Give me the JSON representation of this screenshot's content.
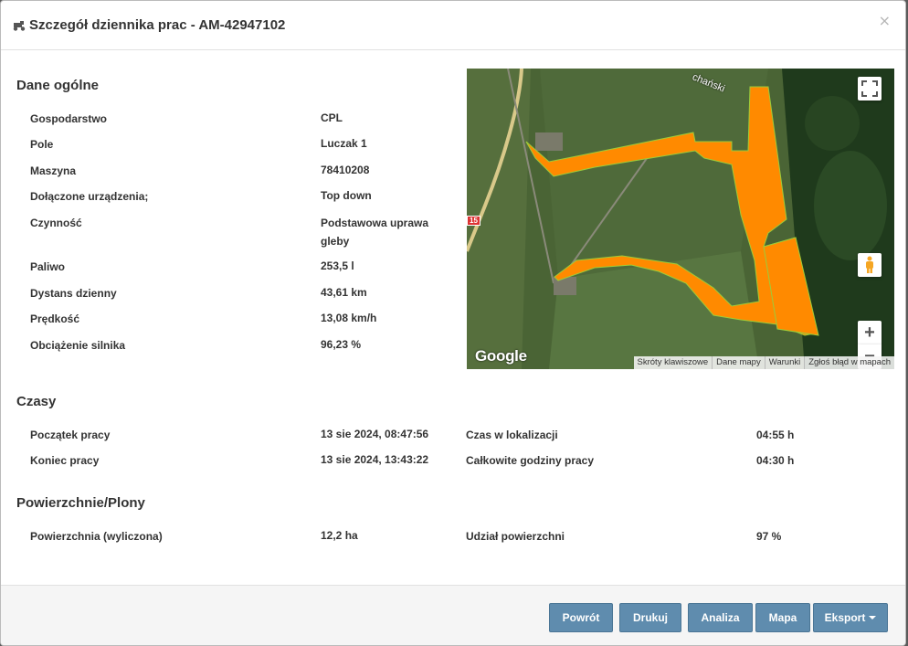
{
  "header": {
    "title": "Szczegół dziennika prac - AM-42947102",
    "close_label": "×"
  },
  "general": {
    "title": "Dane ogólne",
    "rows": [
      {
        "label": "Gospodarstwo",
        "value": "CPL"
      },
      {
        "label": "Pole",
        "value": "Luczak 1"
      },
      {
        "label": "Maszyna",
        "value": "78410208"
      },
      {
        "label": "Dołączone urządzenia;",
        "value": "Top down"
      },
      {
        "label": "Czynność",
        "value": "Podstawowa uprawa gleby"
      },
      {
        "label": "Paliwo",
        "value": "253,5 l"
      },
      {
        "label": "Dystans dzienny",
        "value": "43,61 km"
      },
      {
        "label": "Prędkość",
        "value": "13,08 km/h"
      },
      {
        "label": "Obciążenie silnika",
        "value": "96,23 %"
      }
    ]
  },
  "times": {
    "title": "Czasy",
    "rows": [
      {
        "label": "Początek pracy",
        "value": "13 sie 2024, 08:47:56",
        "label2": "Czas w lokalizacji",
        "value2": "04:55 h"
      },
      {
        "label": "Koniec pracy",
        "value": "13 sie 2024, 13:43:22",
        "label2": "Całkowite godziny pracy",
        "value2": "04:30 h"
      }
    ]
  },
  "areas": {
    "title": "Powierzchnie/Plony",
    "rows": [
      {
        "label": "Powierzchnia (wyliczona)",
        "value": "12,2 ha",
        "label2": "Udział powierzchni",
        "value2": "97 %"
      }
    ]
  },
  "map": {
    "road_label": "chański",
    "road_number": "15",
    "logo": "Google",
    "attribution": [
      "Skróty klawiszowe",
      "Dane mapy",
      "Warunki",
      "Zgłoś błąd w mapach"
    ],
    "zoom_in": "+",
    "zoom_out": "−",
    "track_color": "#ff8a00"
  },
  "footer": {
    "back": "Powrót",
    "print": "Drukuj",
    "analysis": "Analiza",
    "map": "Mapa",
    "export": "Eksport"
  }
}
